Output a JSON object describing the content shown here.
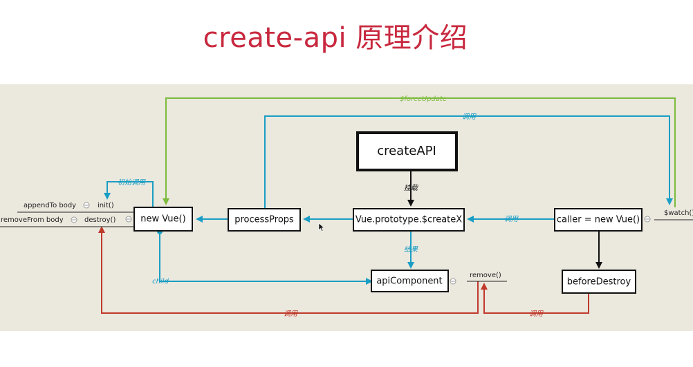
{
  "title": "create-api 原理介绍",
  "colors": {
    "accent": "#c8283e",
    "blue": "#1a9ec4",
    "green": "#7cbb3c",
    "red": "#c0392b",
    "panel": "#ebe8de"
  },
  "nodes": {
    "create_api": "createAPI",
    "new_vue": "new Vue()",
    "process_props": "processProps",
    "create_x": "Vue.prototype.$createX",
    "caller": "caller = new Vue()",
    "api_component": "apiComponent",
    "before_destroy": "beforeDestroy"
  },
  "labels": {
    "force_update": "$forceUpdate",
    "call_top": "调用",
    "mount": "挂载",
    "result": "结果",
    "call_mid": "调用",
    "init_call": "初始调用",
    "child": "child",
    "call_bottom_left": "调用",
    "call_bottom_right": "调用"
  },
  "methods": {
    "append_to_body": "appendTo body",
    "init": "init()",
    "remove_from_body": "removeFrom body",
    "destroy": "destroy()",
    "remove": "remove()",
    "watch": "$watch()"
  }
}
